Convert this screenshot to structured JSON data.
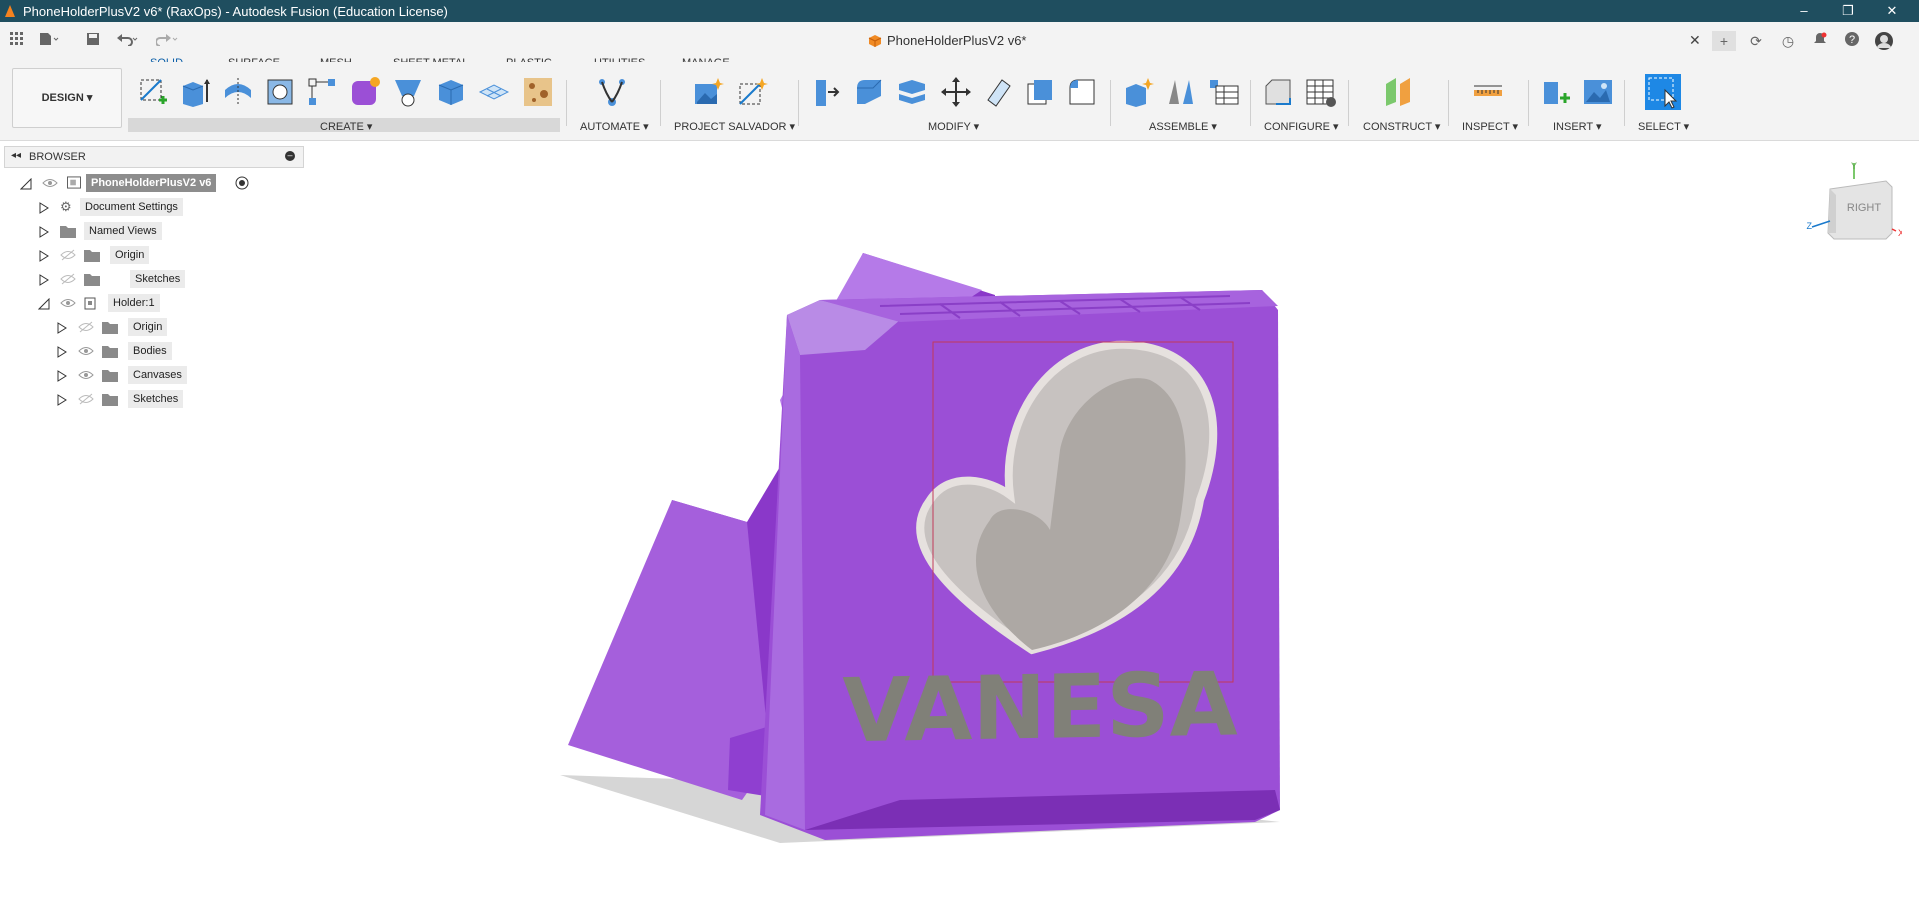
{
  "window": {
    "title": "PhoneHolderPlusV2 v6* (RaxOps) - Autodesk Fusion (Education License)",
    "controls": {
      "minimize": "–",
      "maximize": "❐",
      "close": "✕"
    }
  },
  "document": {
    "tab_title": "PhoneHolderPlusV2 v6*",
    "close_glyph": "✕"
  },
  "workspace": {
    "label": "DESIGN"
  },
  "tabs": [
    "SOLID",
    "SURFACE",
    "MESH",
    "SHEET METAL",
    "PLASTIC",
    "UTILITIES",
    "MANAGE"
  ],
  "toolbar_groups": {
    "create": "CREATE",
    "automate": "AUTOMATE",
    "project_salvador": "PROJECT SALVADOR",
    "modify": "MODIFY",
    "assemble": "ASSEMBLE",
    "configure": "CONFIGURE",
    "construct": "CONSTRUCT",
    "inspect": "INSPECT",
    "insert": "INSERT",
    "select": "SELECT"
  },
  "browser": {
    "header": "BROWSER",
    "root": "PhoneHolderPlusV2 v6",
    "items": [
      {
        "label": "Document Settings",
        "icon": "gear-icon"
      },
      {
        "label": "Named Views",
        "icon": "folder-icon"
      },
      {
        "label": "Origin",
        "icon": "folder-icon"
      },
      {
        "label": "Sketches",
        "icon": "folder-icon"
      },
      {
        "label": "Holder:1",
        "icon": "component-icon"
      },
      {
        "label": "Origin",
        "icon": "folder-icon"
      },
      {
        "label": "Bodies",
        "icon": "folder-icon"
      },
      {
        "label": "Canvases",
        "icon": "folder-icon"
      },
      {
        "label": "Sketches",
        "icon": "folder-icon"
      }
    ]
  },
  "model": {
    "engraved_text": "VANESA",
    "body_color": "#9b4fd6",
    "relief_color": "#b4b0ac"
  },
  "viewcube": {
    "face": "RIGHT",
    "axis_y": "Y",
    "axis_z": "Z",
    "axis_x": "X"
  },
  "colors": {
    "titlebar": "#1f4e5f",
    "accent": "#1a7acc",
    "select": "#1e88e5"
  }
}
